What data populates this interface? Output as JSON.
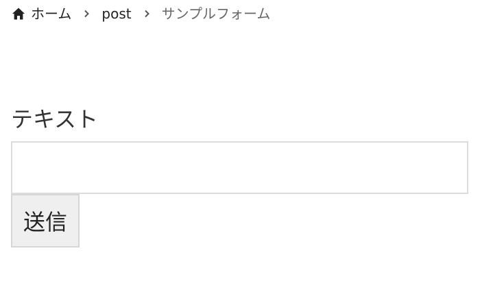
{
  "breadcrumb": {
    "home_label": "ホーム",
    "home_icon": "home-icon",
    "separator_icon": "chevron-right-icon",
    "items": [
      {
        "label": "post"
      },
      {
        "label": "サンプルフォーム"
      }
    ]
  },
  "form": {
    "text_field": {
      "label": "テキスト",
      "value": "",
      "placeholder": ""
    },
    "submit_label": "送信"
  },
  "colors": {
    "text": "#222222",
    "current_crumb": "#666666",
    "input_border": "#dcdcdc",
    "button_bg": "#efefef",
    "button_border": "#d6d6d6"
  }
}
